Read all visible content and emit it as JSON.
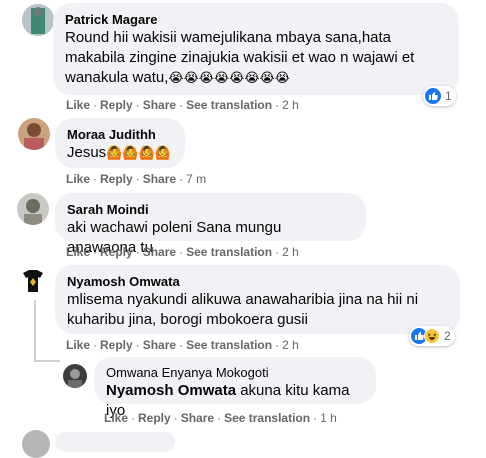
{
  "comments": [
    {
      "name": "Patrick Magare",
      "text": "Round hii wakisii wamejulikana mbaya sana,hata makabila zingine zinajukia wakisii et wao n wajawi et wanakula watu,",
      "emoji": "😭😭😭😭😭😭😭😭",
      "actions": {
        "like": "Like",
        "reply": "Reply",
        "share": "Share",
        "translate": "See translation",
        "time": "2 h"
      },
      "reaction_count": "1"
    },
    {
      "name": "Moraa Judithh",
      "text": "Jesus",
      "emoji": "🙆🙆🙆🙆",
      "actions": {
        "like": "Like",
        "reply": "Reply",
        "share": "Share",
        "time": "7 m"
      }
    },
    {
      "name": "Sarah Moindi",
      "text": "aki wachawi poleni Sana mungu anawaona tu",
      "actions": {
        "like": "Like",
        "reply": "Reply",
        "share": "Share",
        "translate": "See translation",
        "time": "2 h"
      }
    },
    {
      "name": "Nyamosh Omwata",
      "text": "mlisema nyakundi alikuwa anawaharibia jina na hii ni kuharibu jina, borogi mbokoera gusii",
      "actions": {
        "like": "Like",
        "reply": "Reply",
        "share": "Share",
        "translate": "See translation",
        "time": "2 h"
      },
      "reaction_count": "2"
    }
  ],
  "reply": {
    "name": "Omwana Enyanya Mokogoti",
    "mention": "Nyamosh Omwata",
    "text": "akuna kitu kama iyo",
    "actions": {
      "like": "Like",
      "reply": "Reply",
      "share": "Share",
      "translate": "See translation",
      "time": "1 h"
    }
  },
  "colors": {
    "bubble": "#f0f2f5",
    "meta": "#65676b",
    "like_blue": "#1877f2"
  },
  "icons": [
    "like-reaction-icon",
    "haha-reaction-icon"
  ]
}
